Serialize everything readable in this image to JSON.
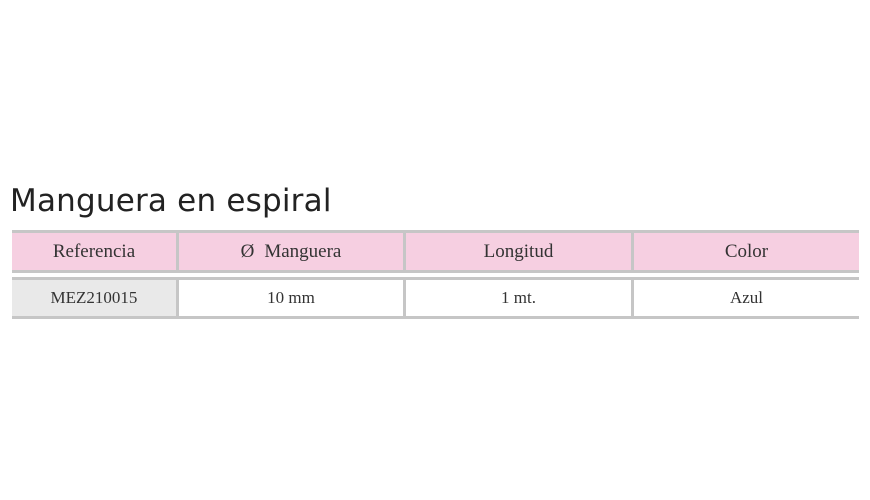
{
  "title": "Manguera en espiral",
  "table": {
    "headers": {
      "reference": "Referencia",
      "diameter_symbol": "Ø",
      "diameter": "Manguera",
      "length": "Longitud",
      "color": "Color"
    },
    "rows": [
      {
        "reference": "MEZ210015",
        "diameter": "10 mm",
        "length": "1 mt.",
        "color": "Azul"
      }
    ]
  },
  "colors": {
    "header_background": "#f6cfe1",
    "border": "#c6c6c6",
    "reference_cell_background": "#e9e9e9"
  }
}
